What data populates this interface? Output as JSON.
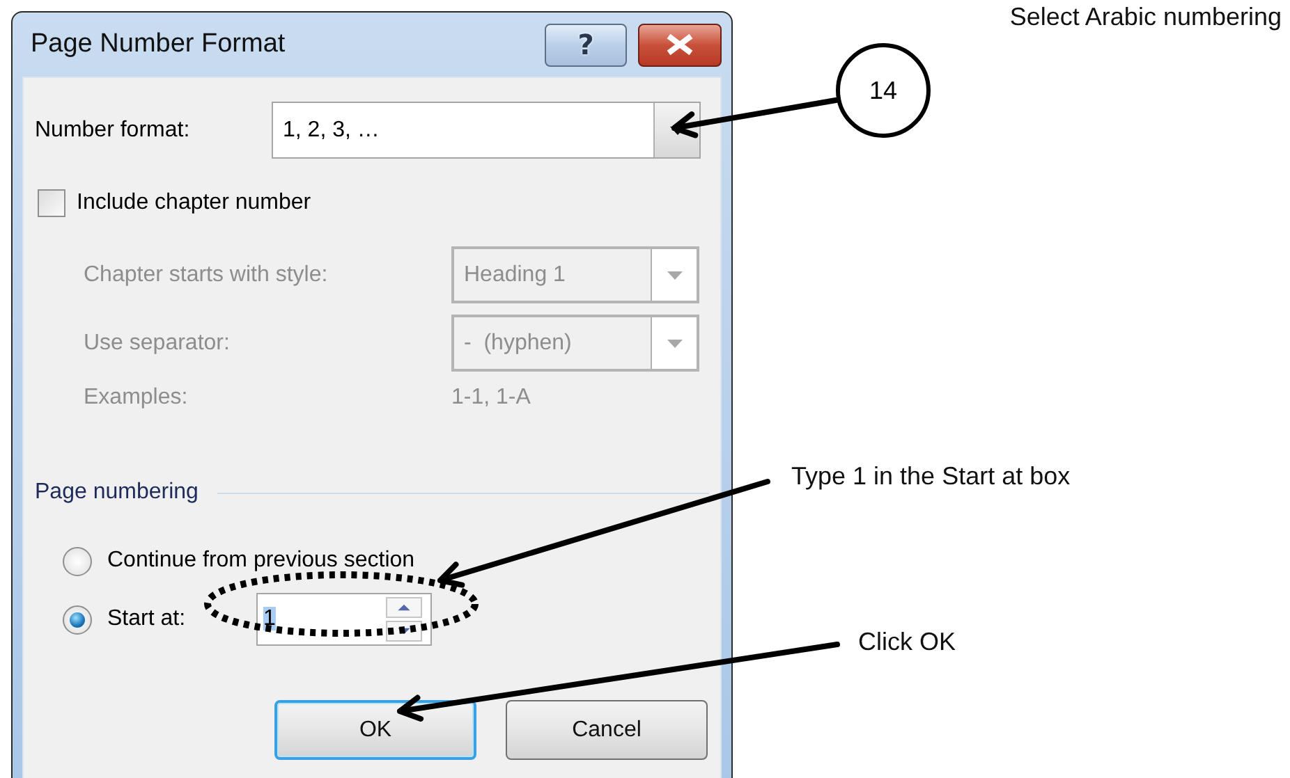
{
  "window": {
    "title": "Page Number Format",
    "help_button": "?"
  },
  "number_format": {
    "label": "Number format:",
    "value": "1, 2, 3, …"
  },
  "include_chapter": {
    "label": "Include chapter number",
    "checked": false
  },
  "chapter_options": {
    "disabled": true,
    "rows": [
      {
        "kind": "dropdown",
        "label": "Chapter starts with style:",
        "value": "Heading 1"
      },
      {
        "kind": "dropdown",
        "label": "Use separator:",
        "value": "-  (hyphen)"
      },
      {
        "kind": "text",
        "label": "Examples:",
        "value": "1-1, 1-A"
      }
    ]
  },
  "page_numbering": {
    "title": "Page numbering",
    "options": [
      {
        "kind": "radio",
        "label": "Continue from previous section",
        "selected": false
      },
      {
        "kind": "spin",
        "label": "Start at:",
        "selected": true,
        "value": "1"
      }
    ]
  },
  "buttons": [
    {
      "label": "OK",
      "default": true
    },
    {
      "label": "Cancel",
      "default": false
    }
  ],
  "annotations": [
    {
      "kind": "callout",
      "text": "Select Arabic numbering",
      "number": "14"
    },
    {
      "kind": "note",
      "text": "Type 1 in the Start at box"
    },
    {
      "kind": "note",
      "text": "Click OK"
    }
  ]
}
